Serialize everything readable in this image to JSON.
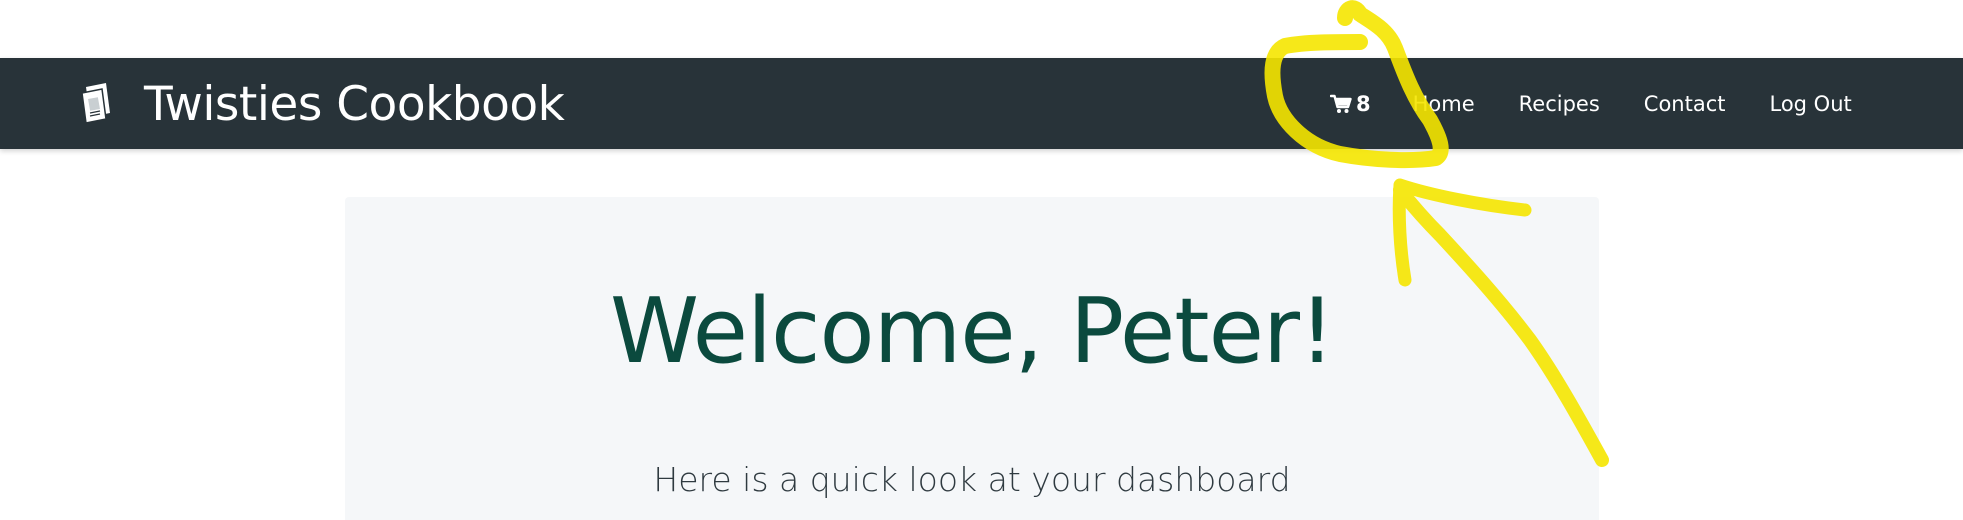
{
  "navbar": {
    "brand": {
      "icon": "cookbook-icon",
      "title": "Twisties Cookbook"
    },
    "cart": {
      "icon": "cart-icon",
      "count": "8"
    },
    "links": [
      {
        "label": "Home"
      },
      {
        "label": "Recipes"
      },
      {
        "label": "Contact"
      },
      {
        "label": "Log Out"
      }
    ]
  },
  "main": {
    "heading": "Welcome, Peter!",
    "subtitle": "Here is a quick look at your dashboard"
  },
  "colors": {
    "navbar_bg": "#283339",
    "heading": "#0b4a3e",
    "jumbotron_bg": "#f5f7f9",
    "annotation_highlight": "#f5e600"
  },
  "annotation": {
    "type": "hand-drawn highlight",
    "shapes": [
      "circle-around-cart",
      "arrow-pointing-to-cart"
    ]
  }
}
